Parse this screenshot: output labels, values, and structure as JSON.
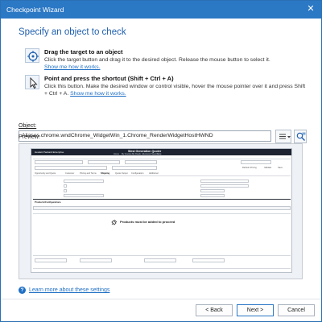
{
  "window": {
    "title": "Checkpoint Wizard"
  },
  "heading": "Specify an object to check",
  "options": [
    {
      "title": "Drag the target to an object",
      "description": "Click the target button and drag it to the desired object. Release the mouse button to select it.",
      "link": "Show me how it works.",
      "icon": "target-icon"
    },
    {
      "title": "Point and press the shortcut (Shift + Ctrl + A)",
      "description": "Click this button. Make the desired window or control visible, hover the mouse pointer over it and press Shift + Ctrl + A.",
      "link": "Show me how it works.",
      "icon": "pointer-cursor-icon"
    }
  ],
  "object": {
    "label": "Object:",
    "value": "Aliases.chrome.wndChrome_WidgetWin_1.Chrome_RenderWidgetHostHWND"
  },
  "preview": {
    "label": "Preview:",
    "app": {
      "brand": "Hewlett Packard Enterprise",
      "title": "West Generation Quoter",
      "nav": [
        "Home",
        "My Quotes",
        "My Deals",
        "Advanced Search",
        "Help"
      ],
      "tabs": [
        "Opportunity and Quote",
        "Customer",
        "Pricing and Terms",
        "Shipping",
        "Quote Output",
        "Configuration",
        "Additional"
      ],
      "section": "Products/Configurations",
      "empty_message": "Products must be added to proceed",
      "buttons": [
        "Refresh Pricing",
        "Validate",
        "Save"
      ]
    }
  },
  "help_link": "Learn more about these settings",
  "buttons": {
    "back": "< Back",
    "next": "Next >",
    "cancel": "Cancel"
  },
  "colors": {
    "titlebar": "#2b78c5",
    "heading": "#1f5fae",
    "link": "#1f6fc4"
  }
}
